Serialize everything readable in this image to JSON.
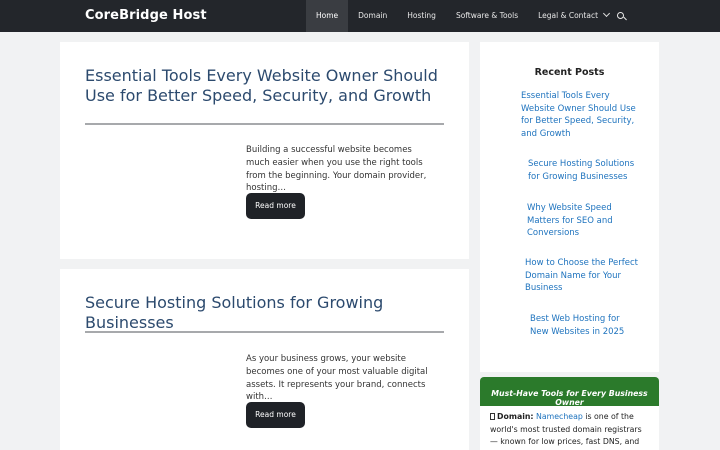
{
  "header": {
    "brand": "CoreBridge Host",
    "nav": [
      {
        "label": "Home",
        "active": true
      },
      {
        "label": "Domain"
      },
      {
        "label": "Hosting"
      },
      {
        "label": "Software & Tools"
      },
      {
        "label": "Legal & Contact",
        "has_dropdown": true
      }
    ],
    "search_icon": "search-icon"
  },
  "posts": [
    {
      "title": "Essential Tools Every Website Owner Should Use for Better Speed, Security, and Growth",
      "excerpt": "Building a successful website becomes much easier when you use the right tools from the beginning. Your domain provider, hosting…",
      "read_more": "Read more"
    },
    {
      "title": "Secure Hosting Solutions for Growing Businesses",
      "excerpt": "As your business grows, your website becomes one of your most valuable digital assets. It represents your brand, connects with…",
      "read_more": "Read more"
    }
  ],
  "sidebar": {
    "heading": "Recent Posts",
    "recent": [
      "Essential Tools Every Website Owner Should Use for Better Speed, Security, and Growth",
      "Secure Hosting Solutions for Growing Businesses",
      "Why Website Speed Matters for SEO and Conversions",
      "How to Choose the Perfect Domain Name for Your Business",
      "Best Web Hosting for New Websites in 2025"
    ],
    "promo": {
      "title": "Must-Have Tools for Every Business Owner",
      "item_label": "Domain:",
      "item_link": "Namecheap",
      "item_text": " is one of the world's most trusted domain registrars — known for low prices, fast DNS, and free privacy"
    }
  },
  "colors": {
    "header_bg": "#23262b",
    "title": "#2c4a6e",
    "link": "#1e73be",
    "button": "#1f2227",
    "promo_green": "#2b7a2b"
  }
}
